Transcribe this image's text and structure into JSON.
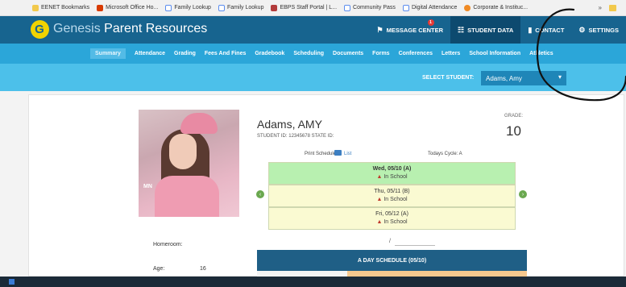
{
  "bookmarks": {
    "items": [
      {
        "label": "EENET Bookmarks",
        "icon": "bookmark-icon",
        "color": "#f2c94c"
      },
      {
        "label": "Microsoft Office Ho...",
        "icon": "office-icon",
        "color": "#d83b01"
      },
      {
        "label": "Family Lookup",
        "icon": "page-icon",
        "color": "#5b8def"
      },
      {
        "label": "Family Lookup",
        "icon": "page-icon",
        "color": "#5b8def"
      },
      {
        "label": "EBPS Staff Portal | L...",
        "icon": "portal-icon",
        "color": "#b23b3b"
      },
      {
        "label": "Community Pass",
        "icon": "page-icon",
        "color": "#5b8def"
      },
      {
        "label": "Digital Attendance",
        "icon": "page-icon",
        "color": "#5b8def"
      },
      {
        "label": "Corporate & Instituc...",
        "icon": "corporate-icon",
        "color": "#f08a24"
      }
    ],
    "more": "»"
  },
  "header": {
    "logo_letter": "G",
    "brand_first": "Genesis",
    "brand_rest": " Parent Resources",
    "nav": [
      {
        "label": "MESSAGE CENTER",
        "icon": "⚑"
      },
      {
        "label": "STUDENT DATA",
        "icon": "☷"
      },
      {
        "label": "CONTACT",
        "icon": "▮"
      },
      {
        "label": "SETTINGS",
        "icon": "⚙"
      }
    ],
    "message_badge": "1"
  },
  "main_nav": {
    "tabs": [
      "Summary",
      "Attendance",
      "Grading",
      "Fees And Fines",
      "Gradebook",
      "Scheduling",
      "Documents",
      "Forms",
      "Conferences",
      "Letters",
      "School Information",
      "Athletics"
    ]
  },
  "student_select": {
    "label": "SELECT STUDENT:",
    "value": "Adams, Amy"
  },
  "student": {
    "name": "Adams, AMY",
    "ids": "STUDENT ID: 12345678   STATE ID:",
    "grade_label": "GRADE:",
    "grade_value": "10",
    "print_schedule_label": "Print Schedule:",
    "print_list": "List",
    "todays_cycle": "Todays Cycle: A",
    "homeroom_label": "Homeroom:",
    "age_label": "Age:",
    "age_value": "16",
    "photo_watermark": "MN"
  },
  "days": [
    {
      "date": "Wed, 05/10 (A)",
      "status": "In School"
    },
    {
      "date": "Thu, 05/11 (B)",
      "status": "In School"
    },
    {
      "date": "Fri, 05/12 (A)",
      "status": "In School"
    }
  ],
  "schedule": {
    "header": "A DAY SCHEDULE (05/10)",
    "slash": "/"
  },
  "colors": {
    "header": "#17648f",
    "main_nav": "#2ba6d9",
    "select_bar": "#4cc0ea",
    "today": "#b8f0b0",
    "other_day": "#fafad2",
    "schedule_header": "#1f5f86"
  }
}
